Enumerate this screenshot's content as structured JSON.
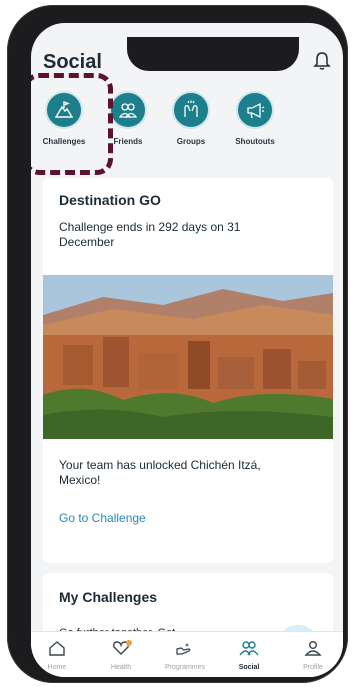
{
  "header": {
    "title": "Social",
    "bell_icon": "bell-icon"
  },
  "categories": [
    {
      "label": "Challenges",
      "icon": "mountain-flag-icon"
    },
    {
      "label": "Friends",
      "icon": "friends-icon"
    },
    {
      "label": "Groups",
      "icon": "high-five-icon"
    },
    {
      "label": "Shoutouts",
      "icon": "megaphone-icon"
    }
  ],
  "challenge_card": {
    "title": "Destination GO",
    "subtitle": "Challenge ends in 292 days on 31 December",
    "unlock_text": "Your team has unlocked Chichén Itzá, Mexico!",
    "link": "Go to Challenge"
  },
  "my_challenges": {
    "title": "My Challenges",
    "cut_text": "Go further together. Get"
  },
  "nav": [
    {
      "label": "Home",
      "icon": "home-icon"
    },
    {
      "label": "Health",
      "icon": "heart-icon"
    },
    {
      "label": "Programmes",
      "icon": "hand-stars-icon"
    },
    {
      "label": "Social",
      "icon": "people-icon"
    },
    {
      "label": "Profile",
      "icon": "person-icon"
    }
  ],
  "colors": {
    "accent": "#1d7e8c",
    "link": "#2b87b5",
    "highlight": "#5b1330",
    "notification": "#f0a23a"
  }
}
